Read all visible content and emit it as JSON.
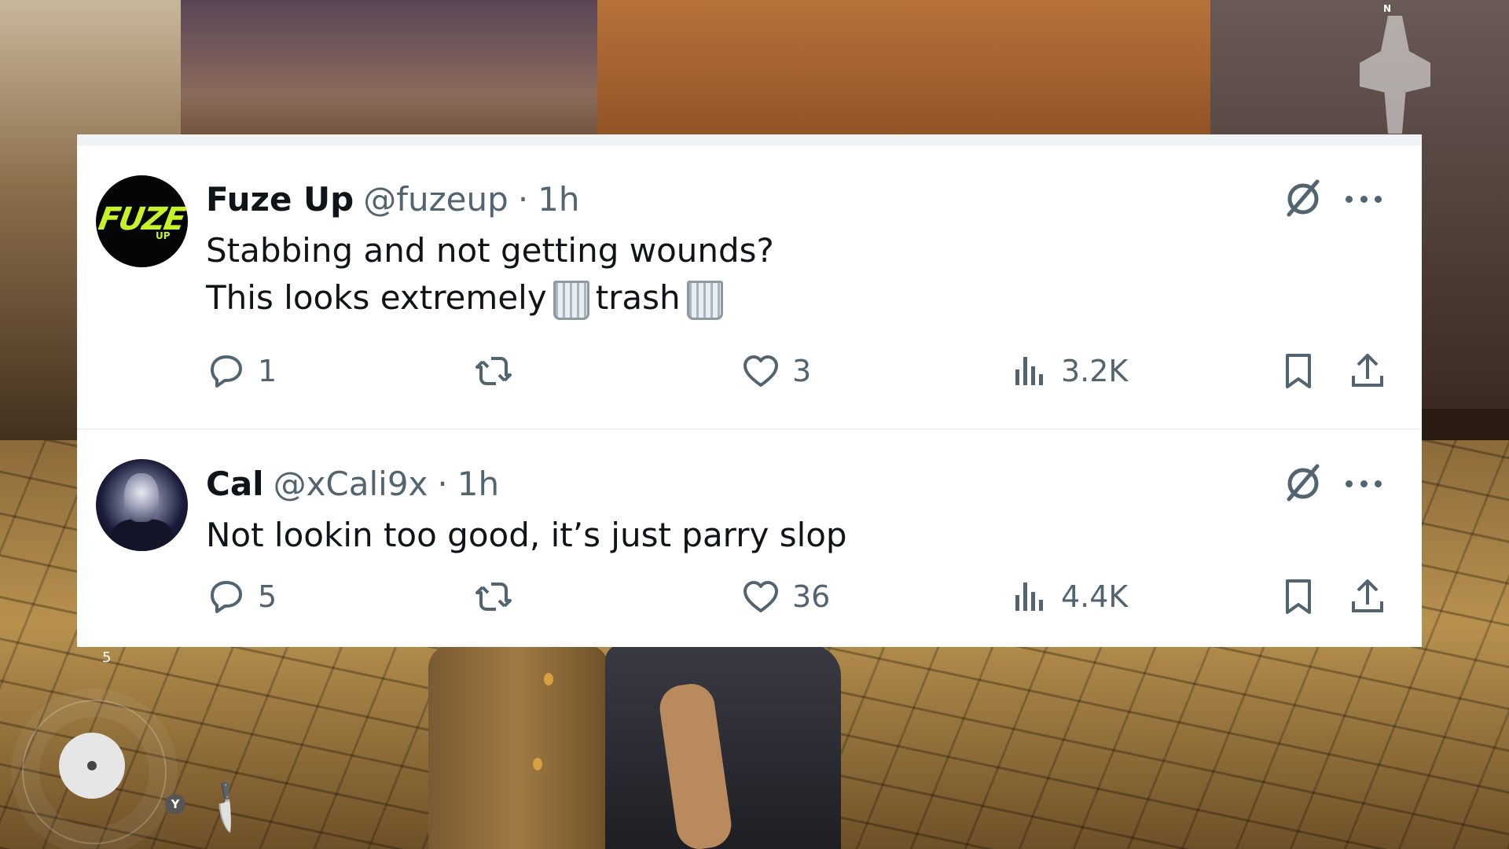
{
  "hud": {
    "item_count": "5",
    "button_y": "Y",
    "compass_n": "N"
  },
  "tweets": [
    {
      "name": "Fuze Up",
      "handle": "@fuzeup",
      "separator": "·",
      "time": "1h",
      "line1": "Stabbing and not getting wounds?",
      "line2_part1": "This looks extremely",
      "line2_part2": "trash",
      "replies": "1",
      "likes": "3",
      "views": "3.2K",
      "avatar_logo": "FUZE",
      "avatar_sub": "UP"
    },
    {
      "name": "Cal",
      "handle": "@xCali9x",
      "separator": "·",
      "time": "1h",
      "line1": "Not lookin too good, it’s just parry slop",
      "replies": "5",
      "likes": "36",
      "views": "4.4K"
    }
  ],
  "colors": {
    "text_primary": "#0f1419",
    "text_secondary": "#536471",
    "panel_bg": "#ffffff",
    "logo_green": "#c7f22a"
  },
  "icons": [
    "reply-icon",
    "retweet-icon",
    "like-icon",
    "views-icon",
    "bookmark-icon",
    "share-icon",
    "grok-icon",
    "more-icon",
    "trash-emoji",
    "knife-icon"
  ]
}
